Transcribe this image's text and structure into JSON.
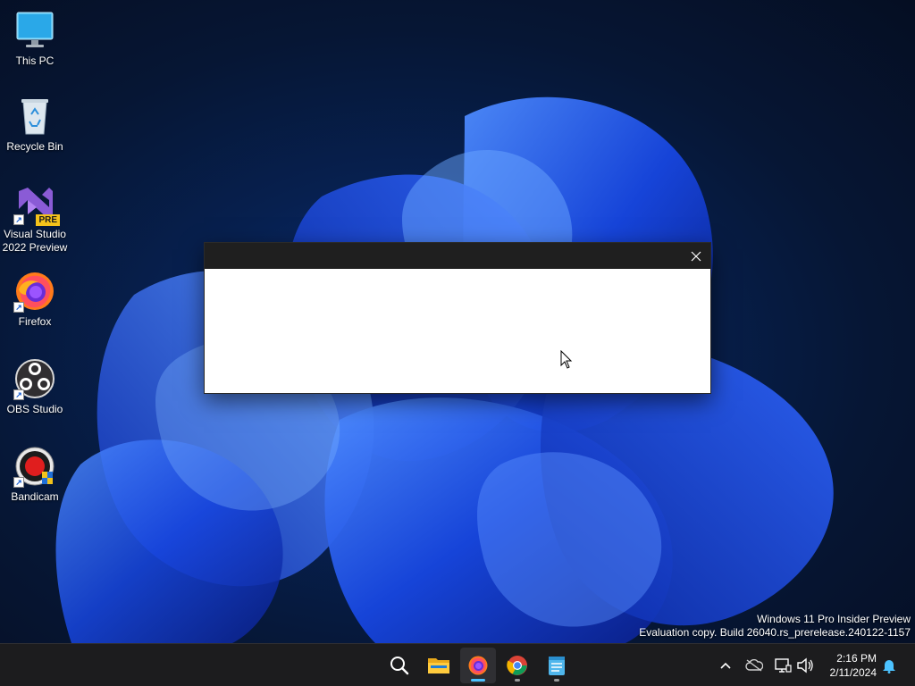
{
  "desktop": {
    "icons": [
      {
        "label_line1": "This PC",
        "label_line2": ""
      },
      {
        "label_line1": "Recycle Bin",
        "label_line2": ""
      },
      {
        "label_line1": "Visual Studio",
        "label_line2": "2022 Preview",
        "badge": "PRE"
      },
      {
        "label_line1": "Firefox",
        "label_line2": ""
      },
      {
        "label_line1": "OBS Studio",
        "label_line2": ""
      },
      {
        "label_line1": "Bandicam",
        "label_line2": ""
      }
    ]
  },
  "dialog": {
    "title": "",
    "close_icon": "close-icon"
  },
  "watermark": {
    "line1": "Windows 11 Pro Insider Preview",
    "line2": "Evaluation copy. Build 26040.rs_prerelease.240122-1157"
  },
  "taskbar": {
    "apps": [
      {
        "name": "Search",
        "icon": "search-icon",
        "state": "none"
      },
      {
        "name": "File Explorer",
        "icon": "folder-icon",
        "state": "none"
      },
      {
        "name": "Firefox",
        "icon": "firefox-icon",
        "state": "active"
      },
      {
        "name": "Google Chrome",
        "icon": "chrome-icon",
        "state": "open"
      },
      {
        "name": "Notepad",
        "icon": "notepad-icon",
        "state": "open"
      }
    ],
    "tray": {
      "time": "2:16 PM",
      "date": "2/11/2024"
    }
  },
  "colors": {
    "accent": "#4cc2ff",
    "taskbar": "#1c1c1e",
    "dialog_titlebar": "#1f1f1f"
  }
}
